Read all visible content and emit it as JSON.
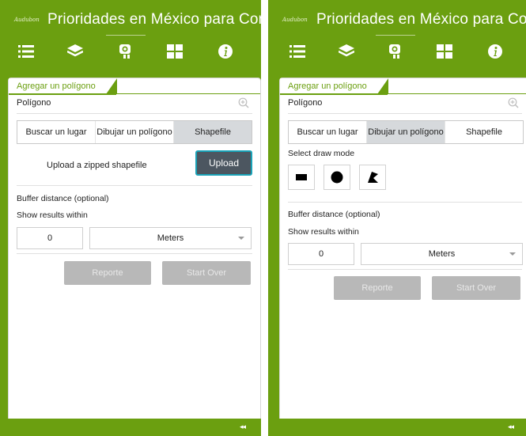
{
  "app": {
    "logo_text": "Audubon",
    "title": "Prioridades en México para Cons"
  },
  "toolbar": {
    "items": [
      {
        "icon": "legend-list-icon",
        "active": false
      },
      {
        "icon": "layers-icon",
        "active": false
      },
      {
        "icon": "analysis-search-icon",
        "active": true
      },
      {
        "icon": "basemap-grid-icon",
        "active": false
      },
      {
        "icon": "info-icon",
        "active": false
      }
    ]
  },
  "panel_left": {
    "tab_label": "Agregar un polígono",
    "section_title": "Polígono",
    "mode_tabs": [
      "Buscar un lugar",
      "Dibujar un polígono",
      "Shapefile"
    ],
    "active_mode": "Shapefile",
    "upload_text": "Upload a zipped shapefile",
    "upload_button": "Upload",
    "buffer_label": "Buffer distance (optional)",
    "show_results_label": "Show results within",
    "distance_value": "0",
    "unit_value": "Meters",
    "report_button": "Reporte",
    "start_over_button": "Start Over"
  },
  "panel_right": {
    "tab_label": "Agregar un polígono",
    "section_title": "Polígono",
    "mode_tabs": [
      "Buscar un lugar",
      "Dibujar un polígono",
      "Shapefile"
    ],
    "active_mode": "Dibujar un polígono",
    "draw_mode_label": "Select draw mode",
    "draw_tools": [
      "rectangle-icon",
      "circle-icon",
      "freehand-polygon-icon"
    ],
    "buffer_label": "Buffer distance (optional)",
    "show_results_label": "Show results within",
    "distance_value": "0",
    "unit_value": "Meters",
    "report_button": "Reporte",
    "start_over_button": "Start Over"
  },
  "footer": {
    "collapse_label": "◂◂"
  },
  "colors": {
    "brand_green": "#6b9f10",
    "upload_button_bg": "#4c5660",
    "upload_button_border": "#1aa3b8",
    "disabled_button_bg": "#b8b8b8",
    "active_tab_bg": "#d6d9dc"
  }
}
